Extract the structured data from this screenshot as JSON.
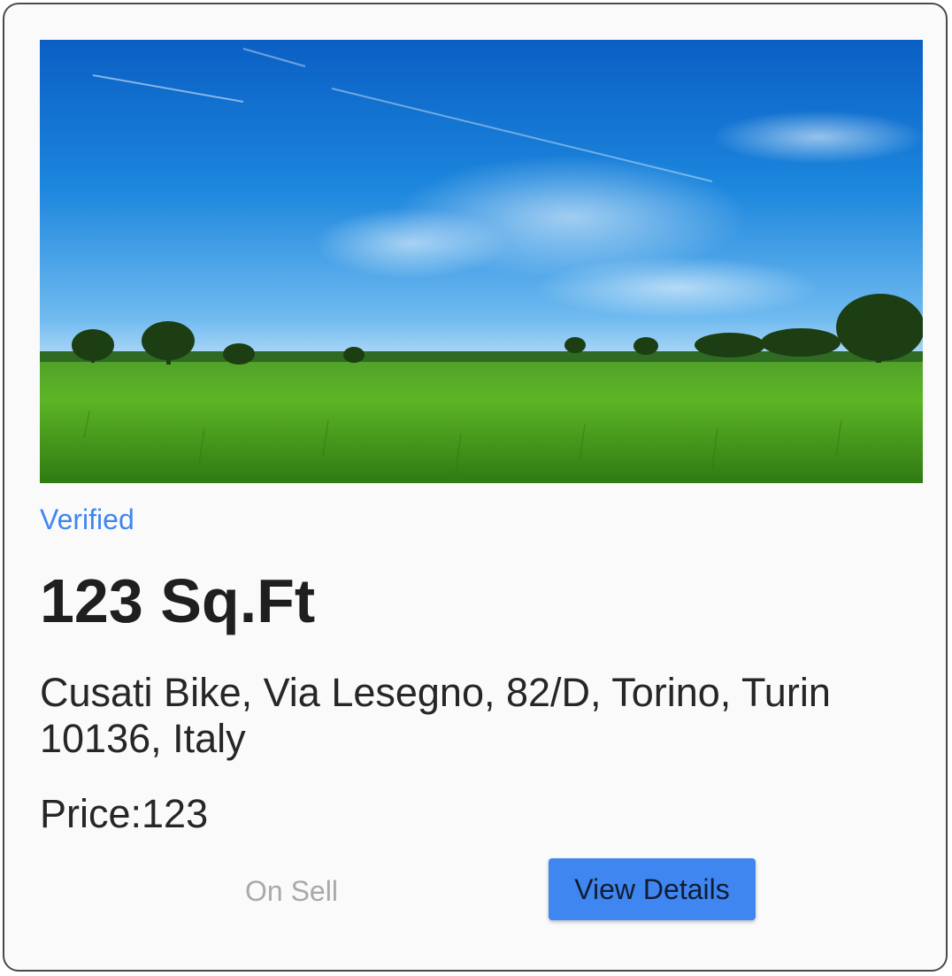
{
  "listing": {
    "status": "Verified",
    "area": "123 Sq.Ft",
    "address": "Cusati Bike, Via Lesegno, 82/D, Torino, Turin 10136, Italy",
    "price_label": "Price:",
    "price_value": "123",
    "sell_state": "On Sell",
    "view_details_label": "View Details"
  },
  "colors": {
    "accent": "#3f86f0",
    "muted": "#a9a9a9",
    "text": "#262626"
  }
}
